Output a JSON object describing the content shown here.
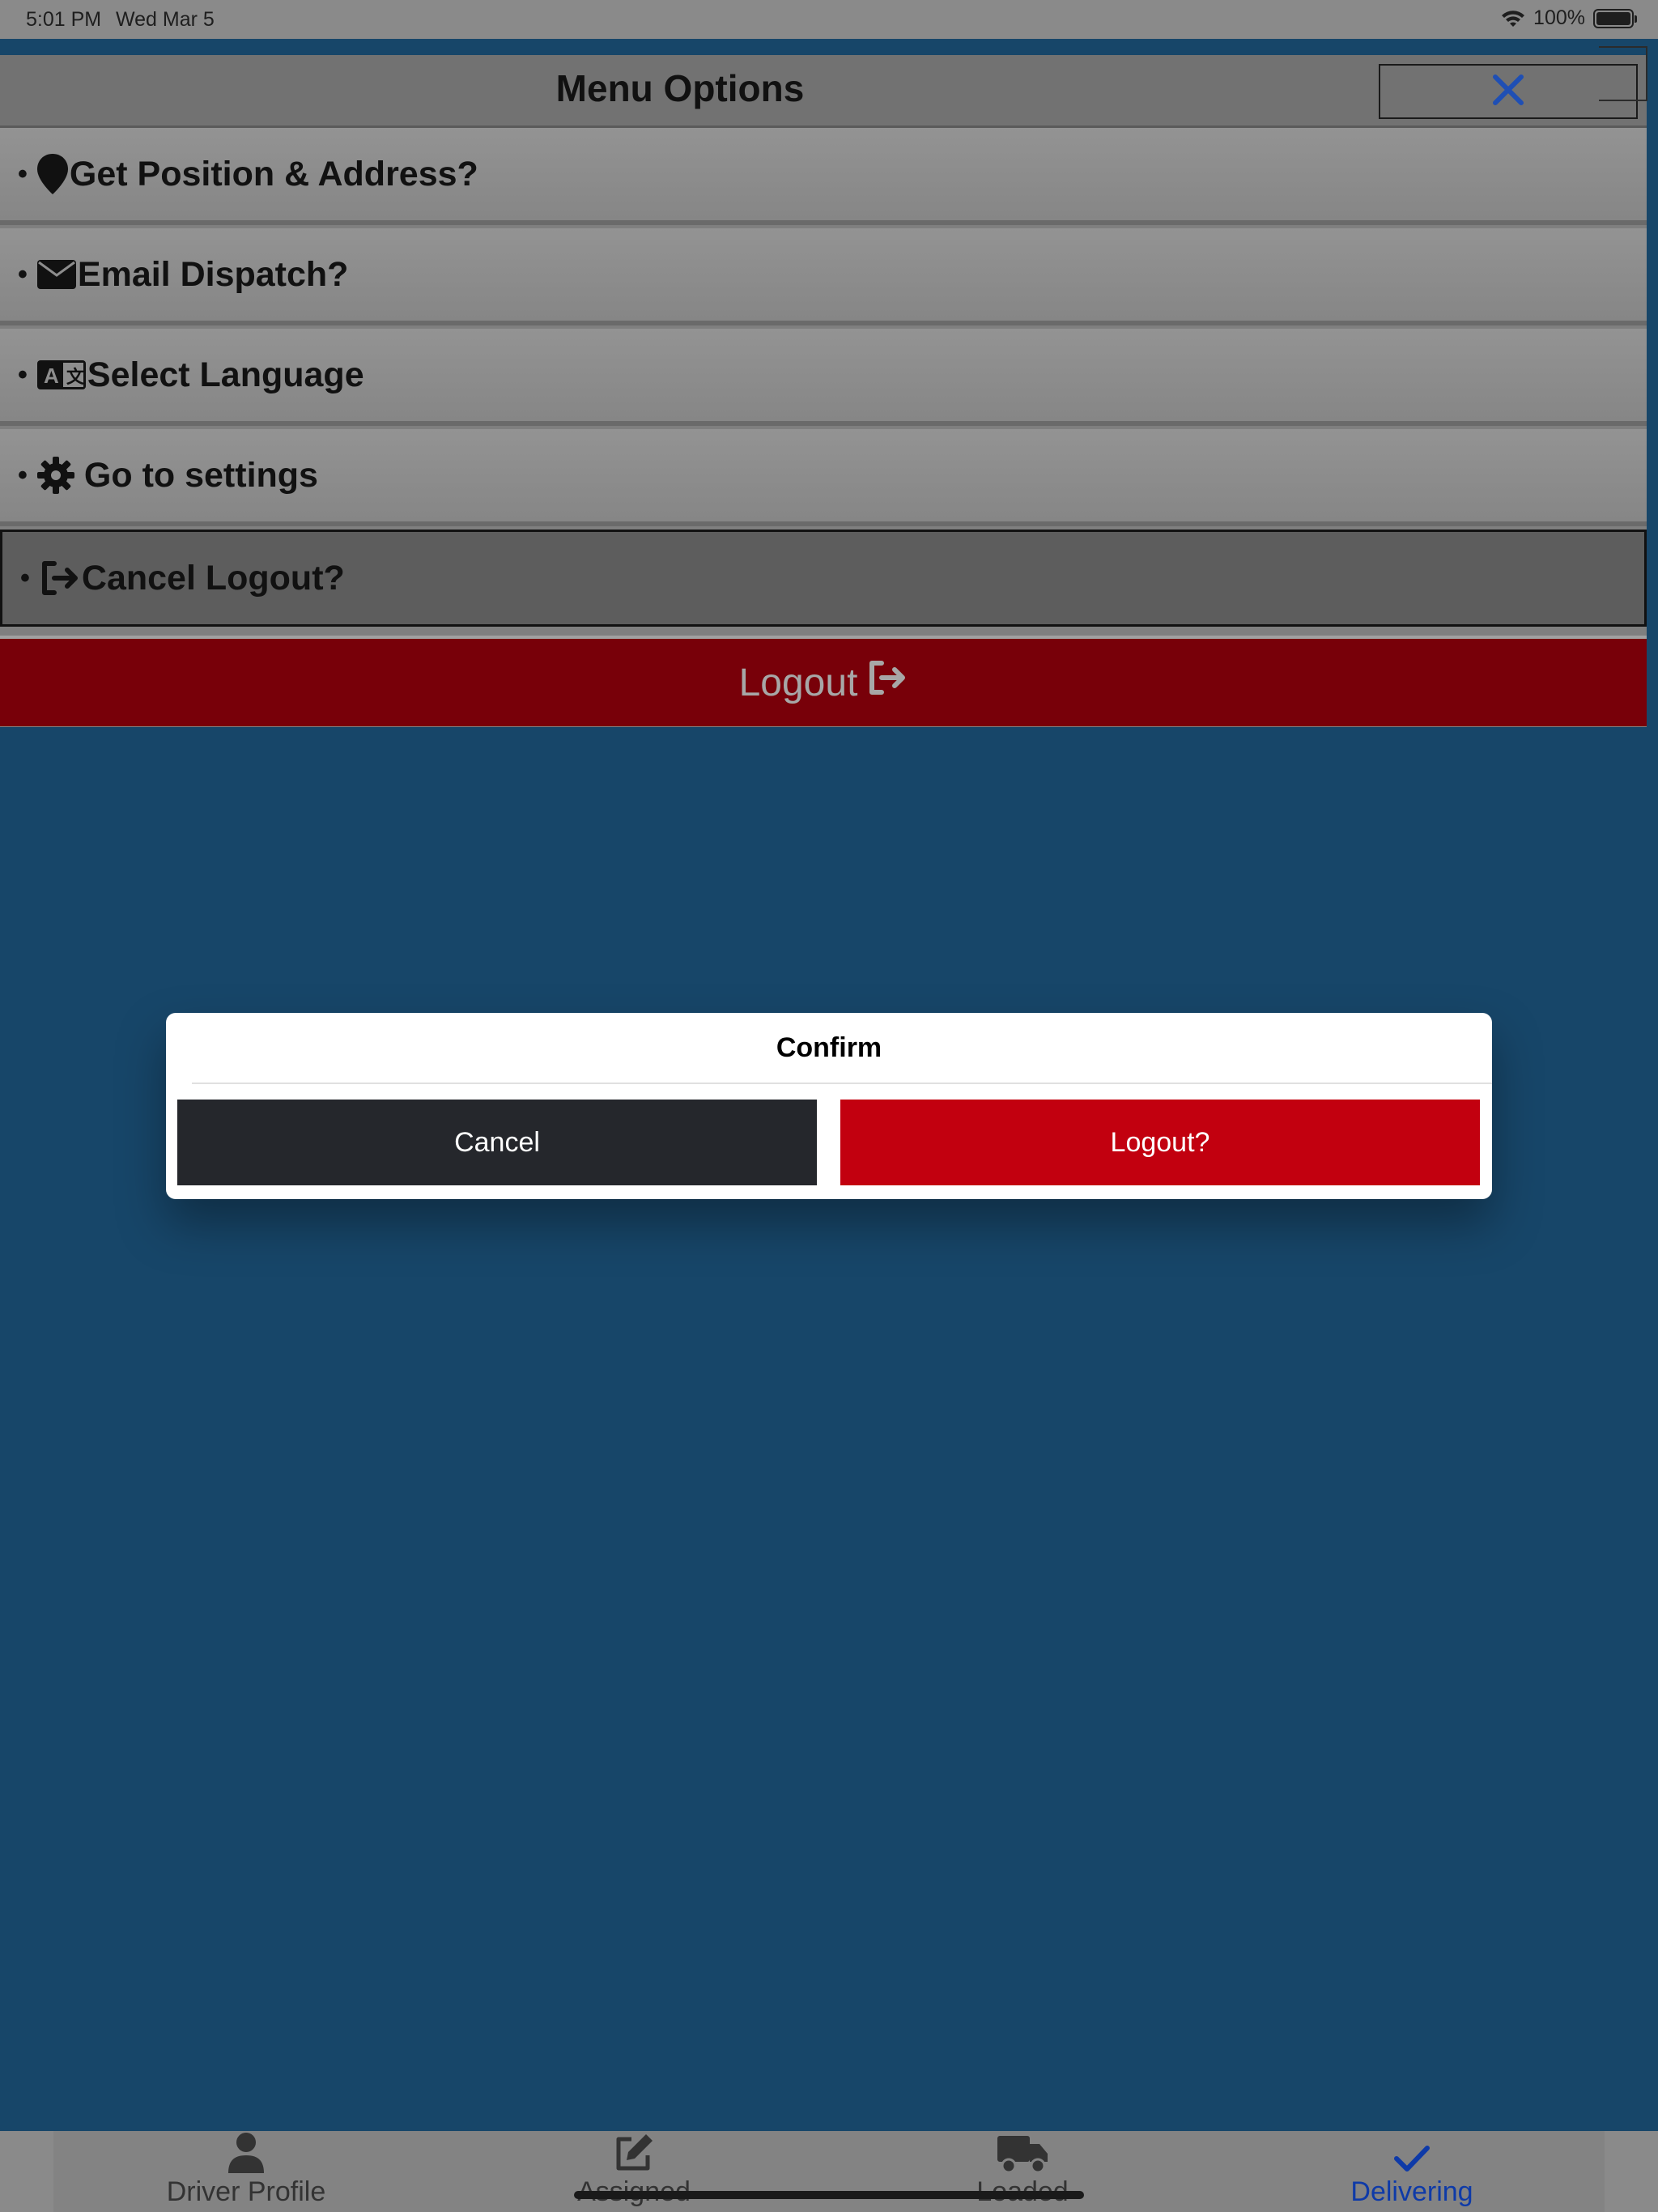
{
  "status_bar": {
    "time": "5:01 PM",
    "date": "Wed Mar 5",
    "battery": "100%",
    "battery_level": 1.0
  },
  "menu": {
    "title": "Menu Options",
    "items": [
      {
        "label": "Get Position & Address?",
        "icon": "map-marker-icon"
      },
      {
        "label": "Email Dispatch?",
        "icon": "envelope-icon"
      },
      {
        "label": "Select Language",
        "icon": "language-icon"
      },
      {
        "label": "Go to settings",
        "icon": "gear-icon"
      },
      {
        "label": "Cancel Logout?",
        "icon": "sign-out-icon"
      }
    ],
    "logout_label": "Logout"
  },
  "dialog": {
    "title": "Confirm",
    "cancel_label": "Cancel",
    "confirm_label": "Logout?"
  },
  "tabs": [
    {
      "label": "Driver Profile",
      "icon": "user-icon"
    },
    {
      "label": "Assigned",
      "icon": "edit-icon"
    },
    {
      "label": "Loaded",
      "icon": "truck-icon"
    },
    {
      "label": "Delivering",
      "icon": "check-icon"
    }
  ],
  "colors": {
    "background": "#174669",
    "logout_red": "#c2000f",
    "active_tab": "#0e3aa8"
  }
}
